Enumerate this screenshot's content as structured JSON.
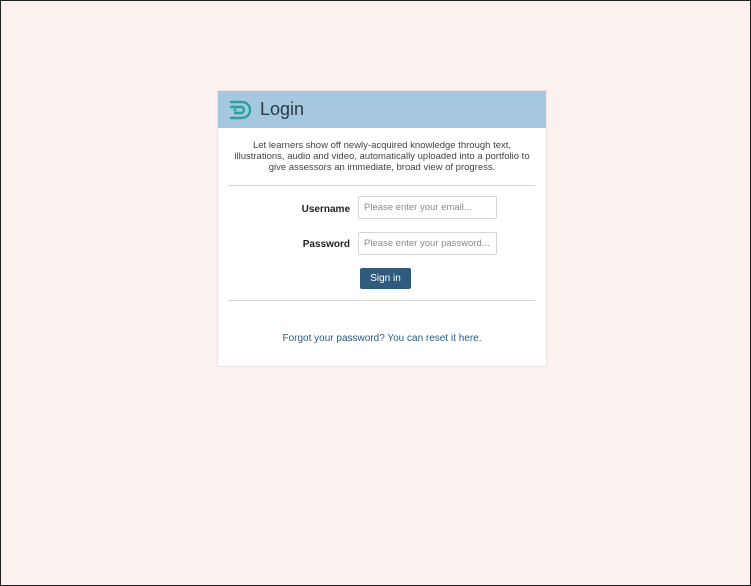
{
  "login": {
    "title": "Login",
    "logo_icon": "login-logo-icon",
    "description": "Let learners show off newly-acquired knowledge through text, illustrations, audio and video, automatically uploaded into a portfolio to give assessors an immediate, broad view of progress.",
    "username_label": "Username",
    "username_placeholder": "Please enter your email...",
    "password_label": "Password",
    "password_placeholder": "Please enter your password...",
    "signin_label": "Sign in",
    "forgot_link": "Forgot your password? You can reset it here."
  },
  "colors": {
    "page_background": "#fbf1ee",
    "header_background": "#a5c8e0",
    "button_background": "#2f5c7e",
    "link_color": "#2a5b84",
    "logo_color": "#2aa19a"
  }
}
